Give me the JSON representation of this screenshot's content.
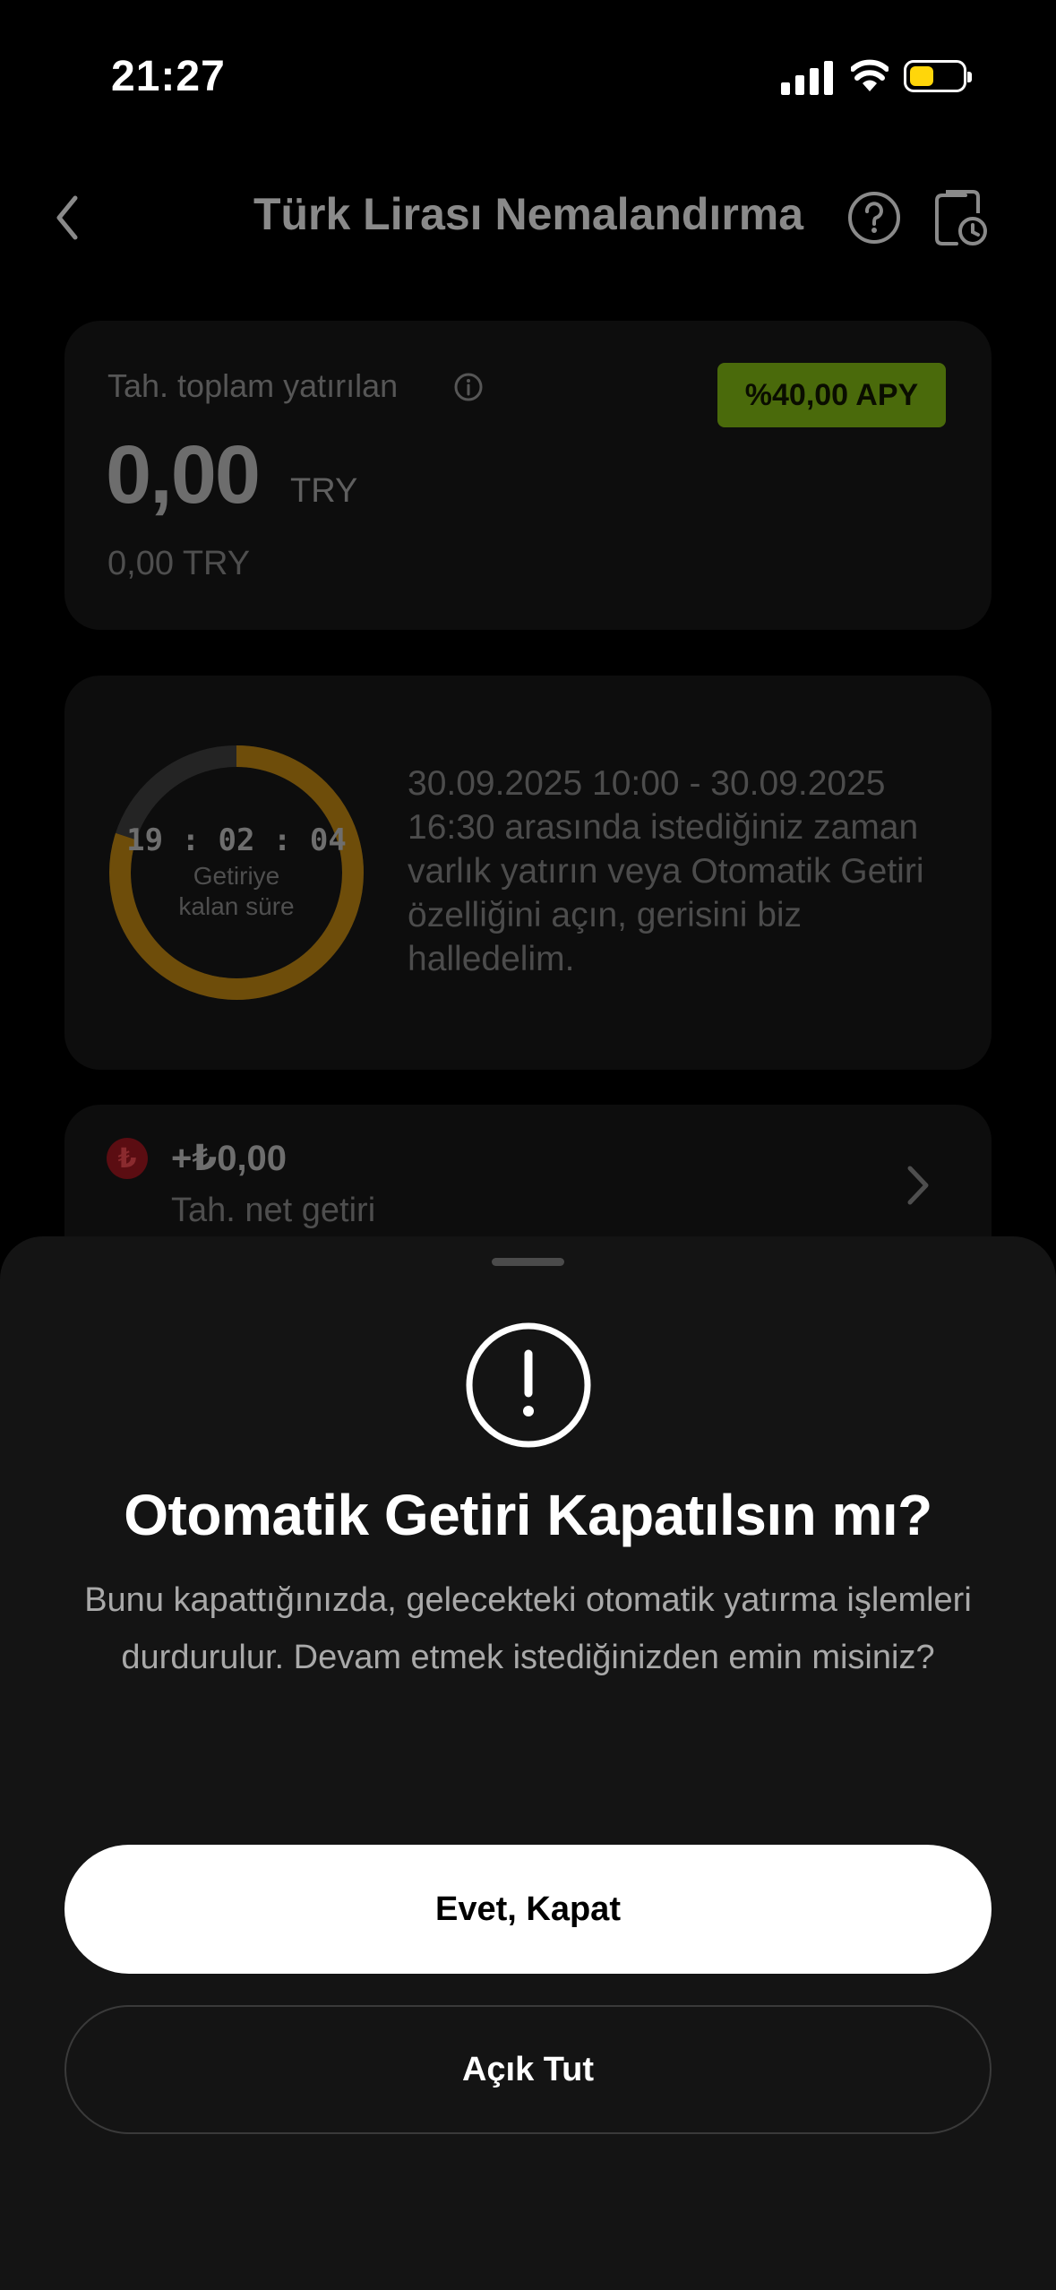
{
  "status_bar": {
    "time": "21:27"
  },
  "header": {
    "title": "Türk Lirası Nemalandırma"
  },
  "summary_card": {
    "label": "Tah. toplam yatırılan",
    "apy_badge": "%40,00 APY",
    "amount": "0,00",
    "currency": "TRY",
    "sub_amount": "0,00 TRY"
  },
  "countdown_card": {
    "time": "19 : 02 : 04",
    "label_line1": "Getiriye",
    "label_line2": "kalan süre",
    "progress": 0.8,
    "description": "30.09.2025 10:00 - 30.09.2025 16:30 arasında istediğiniz zaman varlık yatırın veya Otomatik Getiri özelliğini açın, gerisini biz halledelim.",
    "ring_color": "#6e4d0a"
  },
  "return_card": {
    "icon": "₺",
    "amount": "+₺0,00",
    "label": "Tah. net getiri"
  },
  "sheet": {
    "title": "Otomatik Getiri Kapatılsın mı?",
    "message": "Bunu kapattığınızda, gelecekteki otomatik yatırma işlemleri durdurulur. Devam etmek istediğinizden emin misiniz?",
    "confirm_label": "Evet, Kapat",
    "cancel_label": "Açık Tut"
  },
  "colors": {
    "apy_badge": "#4a6a0b",
    "battery": "#ffd60a",
    "background": "#000000",
    "sheet": "#141414"
  }
}
